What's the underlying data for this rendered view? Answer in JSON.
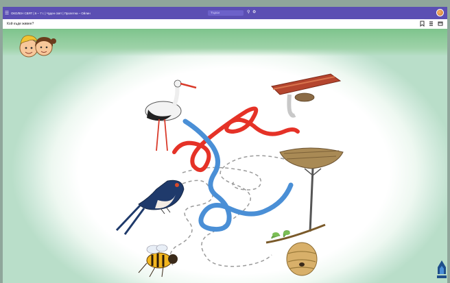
{
  "topbar": {
    "menu_icon": "hamburger-icon",
    "breadcrumb": "ОКОЛЕН СВЯТ | 6 – 7 г. | Чуден свят | Пролетна – Ойлин",
    "search_placeholder": "Търси",
    "search_icon": "search-icon",
    "settings_icon": "gear-icon",
    "avatar_icon": "user-avatar"
  },
  "subbar": {
    "title": "Кой къде живее?",
    "bookmark_icon": "bookmark-icon",
    "list_icon": "list-icon",
    "window_icon": "window-icon"
  },
  "content": {
    "characters": "kids-icon",
    "publisher_logo": "publisher-logo-icon",
    "accent_green": "#7ec48c",
    "red_path": "#e53227",
    "blue_path": "#4a8fd6"
  }
}
